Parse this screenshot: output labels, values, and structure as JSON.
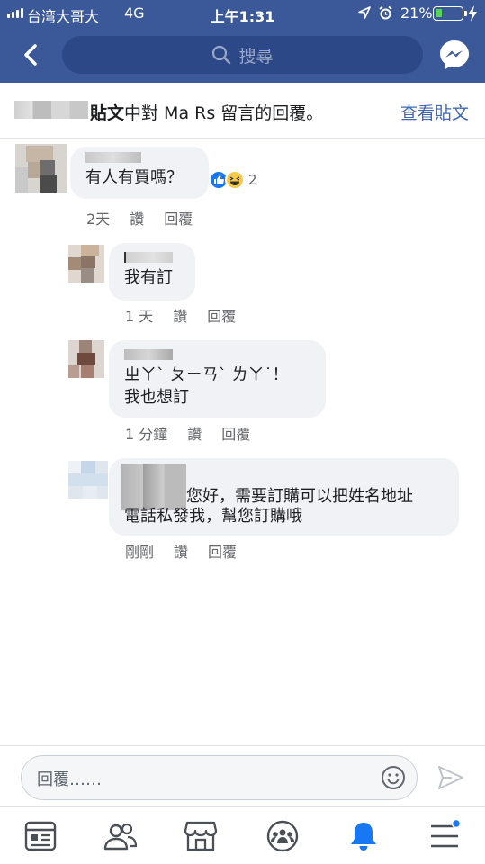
{
  "status_bar": {
    "carrier": "台湾大哥大",
    "network": "4G",
    "time": "上午1:31",
    "battery": "21%"
  },
  "search": {
    "placeholder": "搜尋"
  },
  "page_header": {
    "title_bold": "貼文",
    "title_rest": "中對 Ma Rs 留言的回覆。",
    "view_post": "查看貼文"
  },
  "comments": [
    {
      "text": "有人有買嗎？",
      "time": "2天",
      "like_label": "讚",
      "reply_label": "回覆",
      "reaction_count": "2"
    },
    {
      "text": "我有訂",
      "time": "1 天",
      "like_label": "讚",
      "reply_label": "回覆"
    },
    {
      "text_line1": "ㄓㄚˋ ㄆㄧㄢˋ ㄌㄚ˙！",
      "text_line2": "我也想訂",
      "time": "1 分鐘",
      "like_label": "讚",
      "reply_label": "回覆"
    },
    {
      "text_line1": "您好，需要訂購可以把姓名地址",
      "text_line2": "電話私發我，幫您訂購哦",
      "time": "剛剛",
      "like_label": "讚",
      "reply_label": "回覆"
    }
  ],
  "reply_bar": {
    "placeholder": "回覆……"
  },
  "tabs": [
    {
      "icon": "news-feed-icon"
    },
    {
      "icon": "friends-icon"
    },
    {
      "icon": "marketplace-icon"
    },
    {
      "icon": "groups-icon"
    },
    {
      "icon": "notifications-icon"
    },
    {
      "icon": "menu-icon"
    }
  ],
  "colors": {
    "header_blue": "#3b5998",
    "link_blue": "#4267b2",
    "bubble_gray": "#f0f2f5",
    "active_tab": "#1877f2"
  }
}
